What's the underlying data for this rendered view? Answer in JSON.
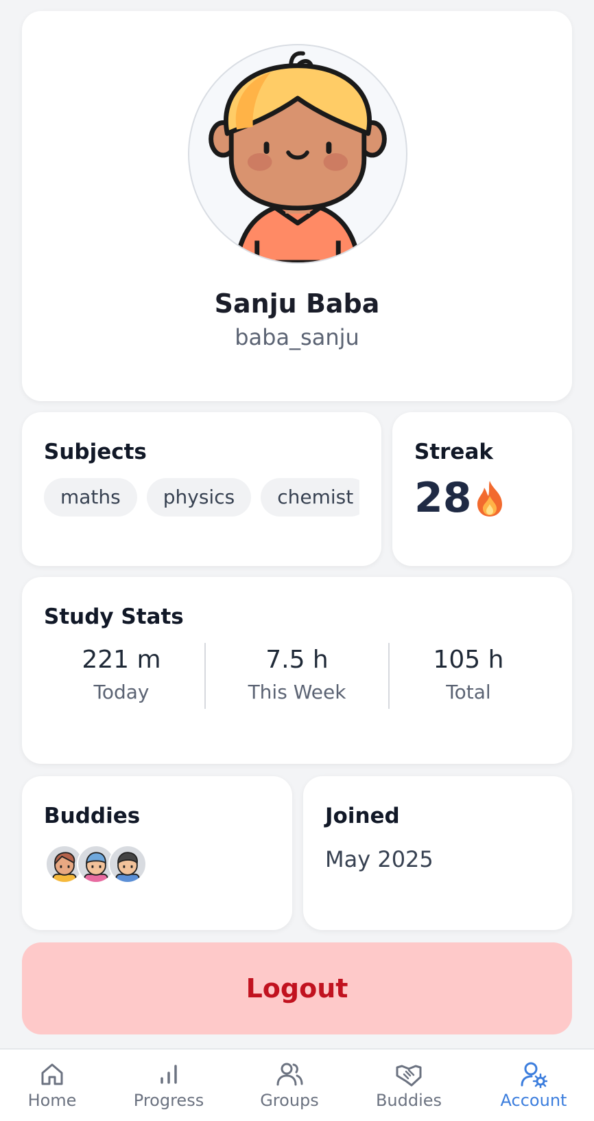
{
  "profile": {
    "name": "Sanju Baba",
    "username": "baba_sanju"
  },
  "subjects": {
    "title": "Subjects",
    "items": [
      "maths",
      "physics",
      "chemist"
    ]
  },
  "streak": {
    "title": "Streak",
    "value": "28",
    "icon": "fire-icon"
  },
  "study_stats": {
    "title": "Study Stats",
    "items": [
      {
        "value": "221 m",
        "label": "Today"
      },
      {
        "value": "7.5 h",
        "label": "This Week"
      },
      {
        "value": "105 h",
        "label": "Total"
      }
    ]
  },
  "buddies": {
    "title": "Buddies",
    "avatars": [
      "buddy-avatar-1",
      "buddy-avatar-2",
      "buddy-avatar-3"
    ]
  },
  "joined": {
    "title": "Joined",
    "value": "May 2025"
  },
  "logout": {
    "label": "Logout"
  },
  "nav": {
    "active": "Account",
    "items": [
      {
        "label": "Home",
        "icon": "home-icon"
      },
      {
        "label": "Progress",
        "icon": "bar-chart-icon"
      },
      {
        "label": "Groups",
        "icon": "users-icon"
      },
      {
        "label": "Buddies",
        "icon": "handshake-icon"
      },
      {
        "label": "Account",
        "icon": "user-settings-icon"
      }
    ]
  },
  "colors": {
    "background": "#f3f4f6",
    "card": "#ffffff",
    "logout_bg": "#fec9c9",
    "logout_text": "#c1121f",
    "accent": "#3b7ddd"
  }
}
